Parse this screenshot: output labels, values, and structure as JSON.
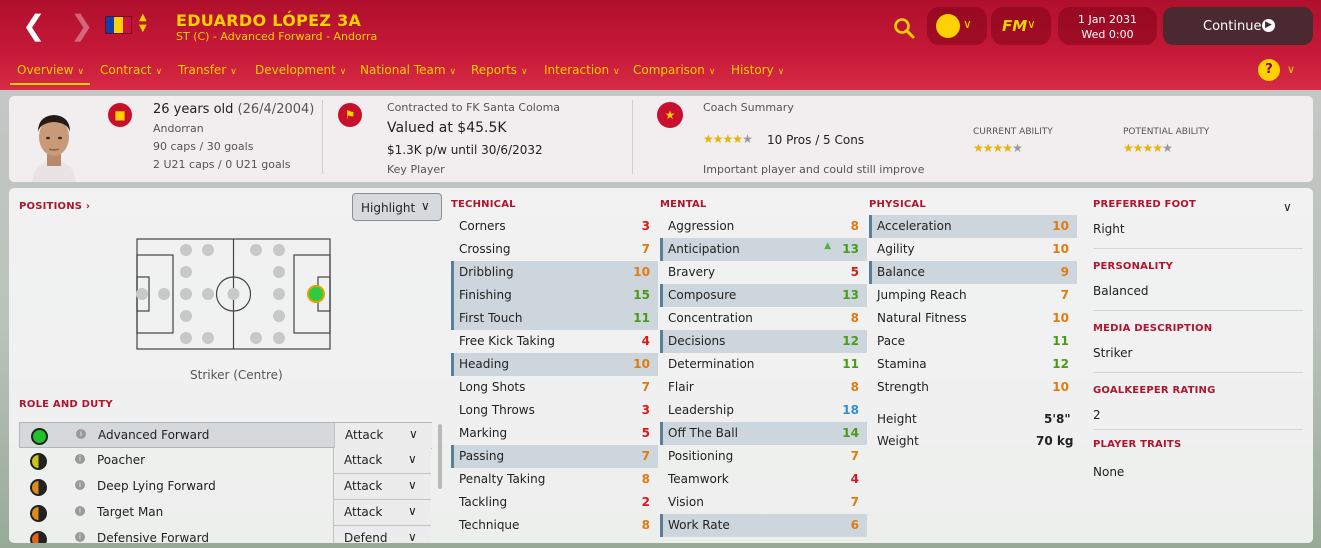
{
  "header": {
    "player_name": "EDUARDO LÓPEZ 3A",
    "player_subtitle": "ST (C) - Advanced Forward - Andorra",
    "flag_colors": [
      "#1240ab",
      "#ffd100",
      "#d0103a"
    ],
    "date_line1": "1 Jan 2031",
    "date_line2": "Wed 0:00",
    "continue_label": "Continue",
    "fm_logo": "FM"
  },
  "tabs": [
    {
      "label": "Overview",
      "active": true
    },
    {
      "label": "Contract"
    },
    {
      "label": "Transfer"
    },
    {
      "label": "Development"
    },
    {
      "label": "National Team"
    },
    {
      "label": "Reports"
    },
    {
      "label": "Interaction"
    },
    {
      "label": "Comparison"
    },
    {
      "label": "History"
    }
  ],
  "info": {
    "age": "26 years old",
    "dob": "(26/4/2004)",
    "nationality": "Andorran",
    "caps": "90 caps / 30 goals",
    "u21_caps": "2 U21 caps / 0 U21 goals",
    "contract_club": "Contracted to FK Santa Coloma",
    "value": "Valued at $45.5K",
    "wage": "$1.3K p/w until 30/6/2032",
    "squad_status": "Key Player",
    "coach_summary_label": "Coach Summary",
    "coach_stars": 4,
    "pros_cons": "10 Pros / 5 Cons",
    "coach_note": "Important player and could still improve",
    "current_ability_label": "CURRENT ABILITY",
    "current_ability_stars": 4,
    "potential_ability_label": "POTENTIAL ABILITY",
    "potential_ability_stars": 4
  },
  "positions": {
    "title": "POSITIONS",
    "highlight_label": "Highlight",
    "position_label": "Striker (Centre)"
  },
  "roles": {
    "title": "ROLE AND DUTY",
    "items": [
      {
        "name": "Advanced Forward",
        "duty": "Attack",
        "dot": "#22c02a",
        "selected": true
      },
      {
        "name": "Poacher",
        "duty": "Attack",
        "dot": "#c8c41a"
      },
      {
        "name": "Deep Lying Forward",
        "duty": "Attack",
        "dot": "#e08a1a"
      },
      {
        "name": "Target Man",
        "duty": "Attack",
        "dot": "#e08a1a"
      },
      {
        "name": "Defensive Forward",
        "duty": "Defend",
        "dot": "#e0641a"
      }
    ]
  },
  "technical": {
    "title": "TECHNICAL",
    "attrs": [
      {
        "name": "Corners",
        "value": 3
      },
      {
        "name": "Crossing",
        "value": 7
      },
      {
        "name": "Dribbling",
        "value": 10,
        "hl": true
      },
      {
        "name": "Finishing",
        "value": 15,
        "hl": true
      },
      {
        "name": "First Touch",
        "value": 11,
        "hl": true
      },
      {
        "name": "Free Kick Taking",
        "value": 4
      },
      {
        "name": "Heading",
        "value": 10,
        "hl": true
      },
      {
        "name": "Long Shots",
        "value": 7
      },
      {
        "name": "Long Throws",
        "value": 3
      },
      {
        "name": "Marking",
        "value": 5
      },
      {
        "name": "Passing",
        "value": 7,
        "hl": true
      },
      {
        "name": "Penalty Taking",
        "value": 8
      },
      {
        "name": "Tackling",
        "value": 2
      },
      {
        "name": "Technique",
        "value": 8
      }
    ]
  },
  "mental": {
    "title": "MENTAL",
    "attrs": [
      {
        "name": "Aggression",
        "value": 8
      },
      {
        "name": "Anticipation",
        "value": 13,
        "hl": true,
        "up": true
      },
      {
        "name": "Bravery",
        "value": 5
      },
      {
        "name": "Composure",
        "value": 13,
        "hl": true
      },
      {
        "name": "Concentration",
        "value": 8
      },
      {
        "name": "Decisions",
        "value": 12,
        "hl": true
      },
      {
        "name": "Determination",
        "value": 11
      },
      {
        "name": "Flair",
        "value": 8
      },
      {
        "name": "Leadership",
        "value": 18
      },
      {
        "name": "Off The Ball",
        "value": 14,
        "hl": true
      },
      {
        "name": "Positioning",
        "value": 7
      },
      {
        "name": "Teamwork",
        "value": 4
      },
      {
        "name": "Vision",
        "value": 7
      },
      {
        "name": "Work Rate",
        "value": 6,
        "hl": true
      }
    ]
  },
  "physical": {
    "title": "PHYSICAL",
    "attrs": [
      {
        "name": "Acceleration",
        "value": 10,
        "hl": true
      },
      {
        "name": "Agility",
        "value": 10
      },
      {
        "name": "Balance",
        "value": 9,
        "hl": true
      },
      {
        "name": "Jumping Reach",
        "value": 7
      },
      {
        "name": "Natural Fitness",
        "value": 10
      },
      {
        "name": "Pace",
        "value": 11
      },
      {
        "name": "Stamina",
        "value": 12
      },
      {
        "name": "Strength",
        "value": 10
      }
    ],
    "height_label": "Height",
    "height": "5'8\"",
    "weight_label": "Weight",
    "weight": "70 kg"
  },
  "side": {
    "preferred_foot_label": "PREFERRED FOOT",
    "preferred_foot": "Right",
    "personality_label": "PERSONALITY",
    "personality": "Balanced",
    "media_label": "MEDIA DESCRIPTION",
    "media": "Striker",
    "gk_label": "GOALKEEPER RATING",
    "gk": "2",
    "traits_label": "PLAYER TRAITS",
    "traits": "None"
  },
  "value_colors": {
    "low": "#d61a1a",
    "mid": "#e07b10",
    "good": "#4a9a1a",
    "great": "#2f8fd8"
  }
}
